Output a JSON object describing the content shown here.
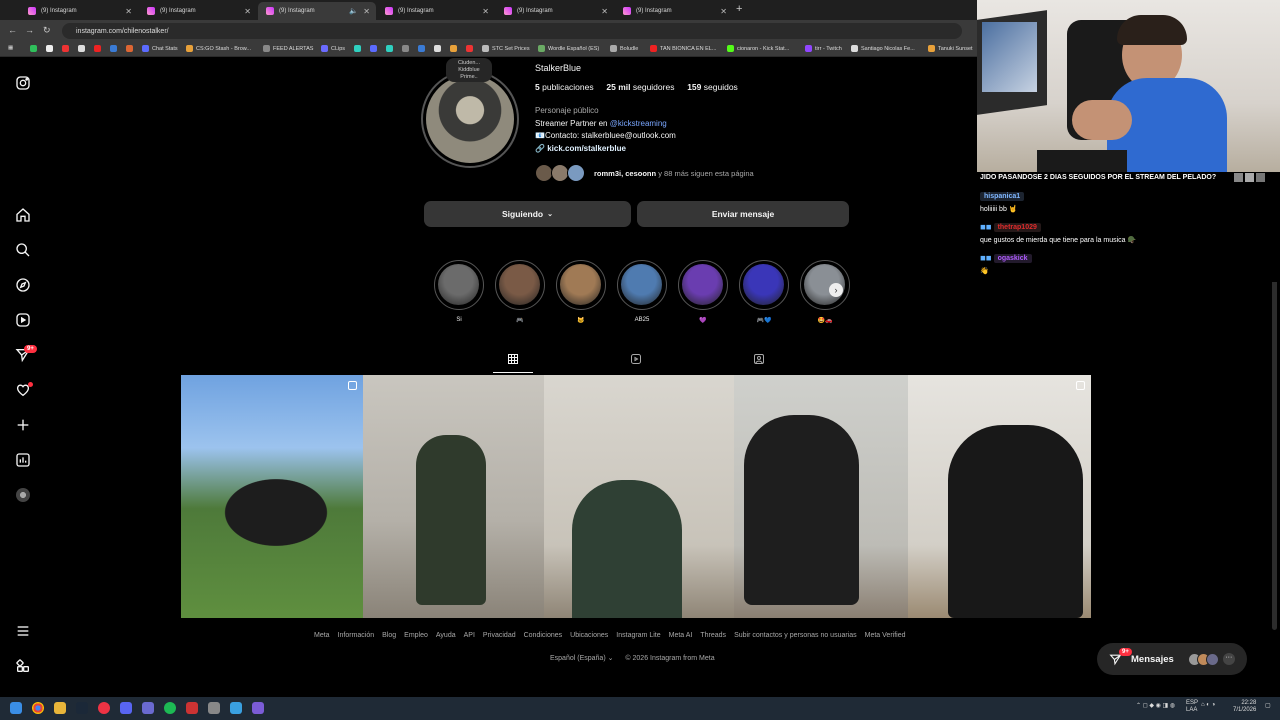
{
  "browser": {
    "tabs": [
      {
        "title": "(9) Instagram",
        "active": false
      },
      {
        "title": "(9) Instagram",
        "active": false
      },
      {
        "title": "(9) Instagram",
        "active": true
      },
      {
        "title": "(9) Instagram",
        "active": false
      },
      {
        "title": "(9) Instagram",
        "active": false
      },
      {
        "title": "(9) Instagram",
        "active": false
      }
    ],
    "url": "instagram.com/chilenostalker/",
    "bookmarks": [
      "Chat Stats",
      "CS:GO Stash - Brow...",
      "FEED ALERTAS",
      "CLips",
      "STC Set Prices",
      "Wordle Español (ES)",
      "Boludle",
      "TAN BIONICA EN EL...",
      "cionaron - Kick Stat...",
      "tirr - Twitch",
      "Santiago Nicolas Fe...",
      "Tanuki Sunset"
    ]
  },
  "sidebar": {
    "notifications_badge": "9+",
    "colors": {
      "badge": "#ff3040"
    }
  },
  "profile": {
    "note": [
      "Ciuden...",
      "Kiddblue",
      "Prime.."
    ],
    "username": "StalkerBlue",
    "posts_count": "5",
    "posts_label": "publicaciones",
    "followers_count": "25 mil",
    "followers_label": "seguidores",
    "following_count": "159",
    "following_label": "seguidos",
    "category": "Personaje público",
    "bio_line1_prefix": "Streamer Partner en ",
    "bio_line1_mention": "@kickstreaming",
    "bio_line2": "📧Contacto: stalkerbluee@outlook.com",
    "link": "kick.com/stalkerblue",
    "followed_by": "romm3i, cesoonn",
    "followed_by_suffix": " y 88 más siguen esta página",
    "following_button": "Siguiendo",
    "message_button": "Enviar mensaje"
  },
  "highlights": [
    {
      "label": "Si",
      "color": "#6b6b6b"
    },
    {
      "label": "🎮",
      "color": "#7a5a46"
    },
    {
      "label": "🐱",
      "color": "#a07a55"
    },
    {
      "label": "AB25",
      "color": "#4f7bb0"
    },
    {
      "label": "💜",
      "color": "#6a3db0"
    },
    {
      "label": "🎮💙",
      "color": "#3a36b8"
    },
    {
      "label": "🤩🚗",
      "color": "#8a8f95"
    }
  ],
  "footer": {
    "links": [
      "Meta",
      "Información",
      "Blog",
      "Empleo",
      "Ayuda",
      "API",
      "Privacidad",
      "Condiciones",
      "Ubicaciones",
      "Instagram Lite",
      "Meta AI",
      "Threads",
      "Subir contactos y personas no usuarias",
      "Meta Verified"
    ],
    "language": "Español (España)",
    "copyright": "© 2026 Instagram from Meta"
  },
  "messages": {
    "label": "Mensajes",
    "badge": "9+"
  },
  "stream_chat": {
    "title": "JIDO PASANDOSE 2 DIAS SEGUIDOS POR EL STREAM DEL PELADO?",
    "messages": [
      {
        "user": "hispanica1",
        "text": "holiiiii bb 🤘",
        "color": "#7fb6ff"
      },
      {
        "user": "thetrap1029",
        "text": "que gustos de mierda que tiene para la musica 🪖",
        "color": "#e02b2b"
      },
      {
        "user": "ogaskick",
        "text": "👋",
        "color": "#b05cff"
      }
    ]
  },
  "taskbar": {
    "lang": "ESP",
    "lang2": "LAA",
    "time": "22:28",
    "date": "7/1/2026"
  }
}
